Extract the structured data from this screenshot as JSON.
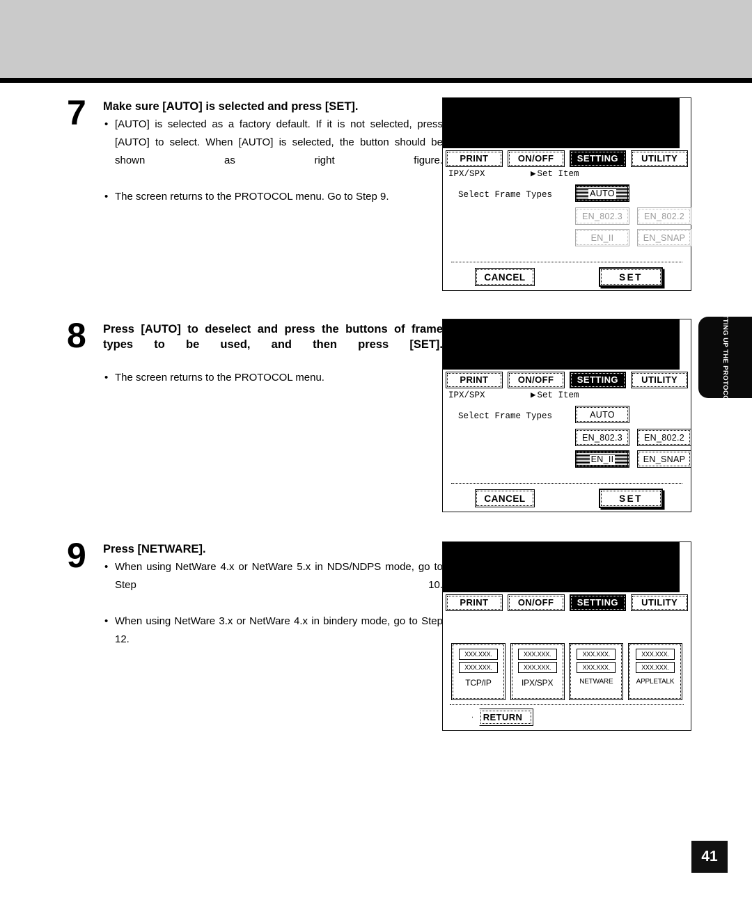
{
  "page": {
    "number": "41",
    "side_tab": "SETTING UP THE PROTOCOLS"
  },
  "steps": [
    {
      "number": "7",
      "title": "Make sure [AUTO] is selected and press [SET].",
      "bullets": [
        "[AUTO] is selected as a factory default.  If it is not selected, press [AUTO] to select.  When [AUTO] is selected, the button should be shown as right figure.",
        "The screen returns to the PROTOCOL menu.  Go to Step 9."
      ]
    },
    {
      "number": "8",
      "title": "Press [AUTO] to deselect and press the buttons of frame types to be used, and then press [SET].",
      "bullets": [
        "The screen returns to the PROTOCOL menu."
      ]
    },
    {
      "number": "9",
      "title": "Press [NETWARE].",
      "bullets": [
        "When using NetWare 4.x or NetWare 5.x in NDS/NDPS mode, go to Step 10.",
        "When using NetWare 3.x or NetWare 4.x in bindery mode, go to Step 12."
      ]
    }
  ],
  "panels": {
    "tabs": [
      {
        "label": "PRINT"
      },
      {
        "label": "ON/OFF"
      },
      {
        "label": "SETTING"
      },
      {
        "label": "UTILITY"
      }
    ],
    "active_tab": "SETTING",
    "panel1": {
      "header_left": "IPX/SPX",
      "header_arrow": "▶",
      "header_right": "Set Item",
      "frame_label": "Select Frame Types",
      "buttons": [
        {
          "label": "AUTO",
          "state": "selected"
        },
        {
          "label": "EN_802.3",
          "state": "disabled"
        },
        {
          "label": "EN_802.2",
          "state": "disabled"
        },
        {
          "label": "EN_II",
          "state": "disabled"
        },
        {
          "label": "EN_SNAP",
          "state": "disabled"
        }
      ],
      "cancel_label": "CANCEL",
      "set_label": "SET"
    },
    "panel2": {
      "header_left": "IPX/SPX",
      "header_arrow": "▶",
      "header_right": "Set Item",
      "frame_label": "Select Frame Types",
      "buttons": [
        {
          "label": "AUTO",
          "state": "normal"
        },
        {
          "label": "EN_802.3",
          "state": "normal"
        },
        {
          "label": "EN_802.2",
          "state": "normal"
        },
        {
          "label": "EN_II",
          "state": "selected"
        },
        {
          "label": "EN_SNAP",
          "state": "normal"
        }
      ],
      "cancel_label": "CANCEL",
      "set_label": "SET"
    },
    "panel3": {
      "protocols": [
        {
          "name": "TCP/IP",
          "line1": "XXX.XXX.",
          "line2": "XXX.XXX."
        },
        {
          "name": "IPX/SPX",
          "line1": "XXX.XXX.",
          "line2": "XXX.XXX."
        },
        {
          "name": "NETWARE",
          "line1": "XXX.XXX.",
          "line2": "XXX.XXX."
        },
        {
          "name": "APPLETALK",
          "line1": "XXX.XXX.",
          "line2": "XXX.XXX."
        }
      ],
      "return_label": "RETURN"
    }
  }
}
